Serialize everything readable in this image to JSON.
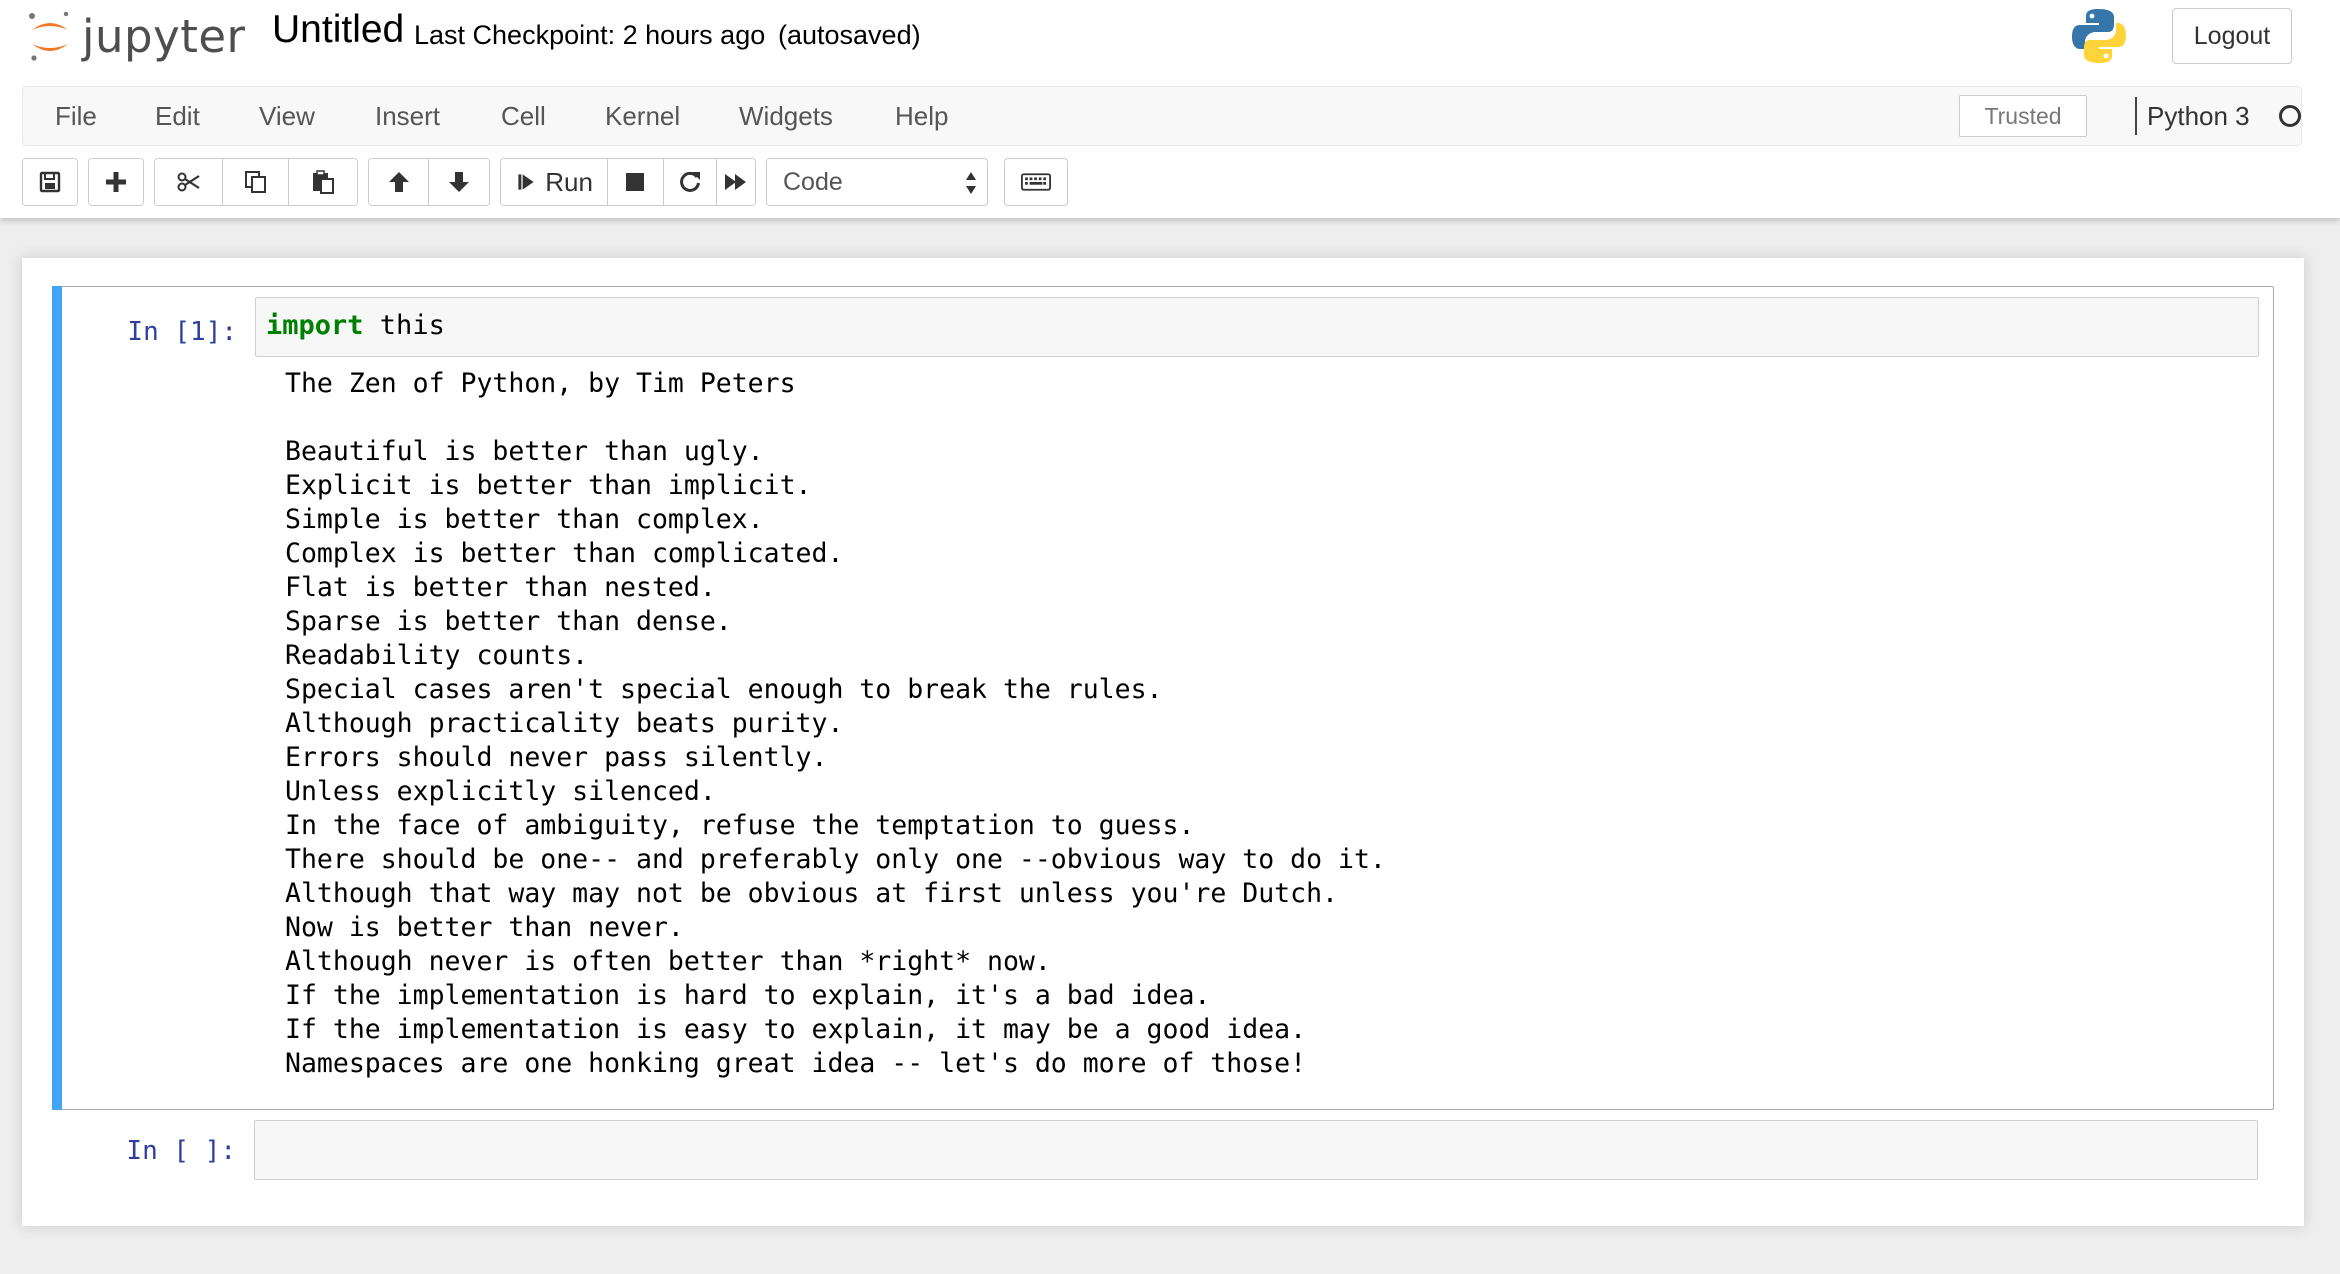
{
  "header": {
    "logo_text": "jupyter",
    "notebook_title": "Untitled",
    "checkpoint": "Last Checkpoint: 2 hours ago",
    "autosave_status": "(autosaved)",
    "logout_label": "Logout"
  },
  "menubar": {
    "items": [
      "File",
      "Edit",
      "View",
      "Insert",
      "Cell",
      "Kernel",
      "Widgets",
      "Help"
    ],
    "trusted_label": "Trusted",
    "kernel_name": "Python 3"
  },
  "toolbar": {
    "run_label": "Run",
    "cell_type": "Code",
    "cell_type_options": [
      "Code"
    ]
  },
  "cells": [
    {
      "prompt": "In [1]:",
      "code_keyword": "import",
      "code_rest": " this",
      "output_lines": [
        "The Zen of Python, by Tim Peters",
        "",
        "Beautiful is better than ugly.",
        "Explicit is better than implicit.",
        "Simple is better than complex.",
        "Complex is better than complicated.",
        "Flat is better than nested.",
        "Sparse is better than dense.",
        "Readability counts.",
        "Special cases aren't special enough to break the rules.",
        "Although practicality beats purity.",
        "Errors should never pass silently.",
        "Unless explicitly silenced.",
        "In the face of ambiguity, refuse the temptation to guess.",
        "There should be one-- and preferably only one --obvious way to do it.",
        "Although that way may not be obvious at first unless you're Dutch.",
        "Now is better than never.",
        "Although never is often better than *right* now.",
        "If the implementation is hard to explain, it's a bad idea.",
        "If the implementation is easy to explain, it may be a good idea.",
        "Namespaces are one honking great idea -- let's do more of those!"
      ]
    },
    {
      "prompt": "In [ ]:",
      "code_keyword": "",
      "code_rest": ""
    }
  ],
  "colors": {
    "selected_cell_bar": "#42a5f5",
    "prompt": "#303f9f",
    "keyword": "#008000",
    "jupyter_orange": "#f37726"
  }
}
